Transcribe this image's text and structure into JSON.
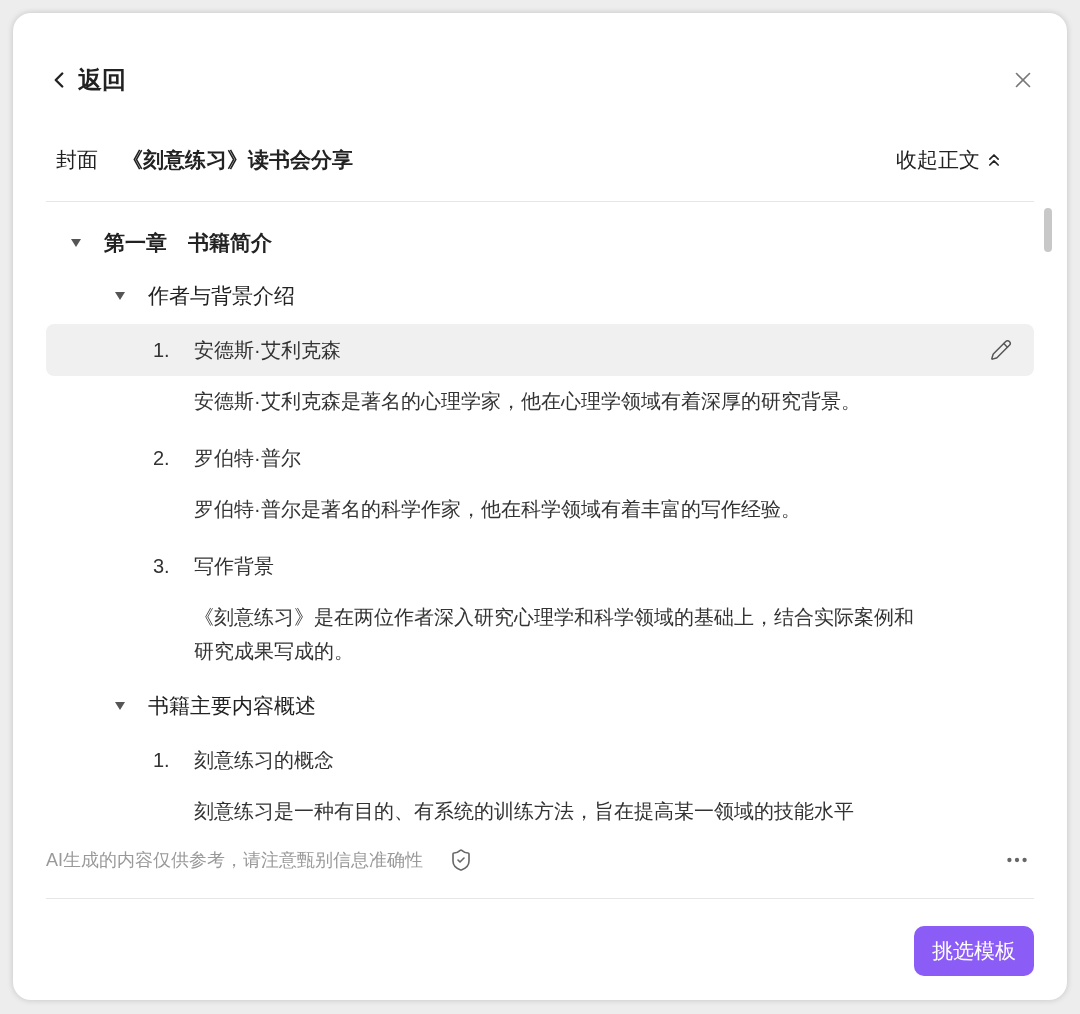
{
  "header": {
    "back_label": "返回"
  },
  "doc": {
    "cover_label": "封面",
    "title": "《刻意练习》读书会分享",
    "collapse_label": "收起正文"
  },
  "outline": [
    {
      "title": "第一章　书籍简介",
      "expanded": true,
      "children": [
        {
          "title": "作者与背景介绍",
          "expanded": true,
          "items": [
            {
              "number": "1.",
              "title": "安德斯·艾利克森",
              "selected": true,
              "body": "安德斯·艾利克森是著名的心理学家，他在心理学领域有着深厚的研究背景。"
            },
            {
              "number": "2.",
              "title": "罗伯特·普尔",
              "selected": false,
              "body": "罗伯特·普尔是著名的科学作家，他在科学领域有着丰富的写作经验。"
            },
            {
              "number": "3.",
              "title": "写作背景",
              "selected": false,
              "body": "《刻意练习》是在两位作者深入研究心理学和科学领域的基础上，结合实际案例和研究成果写成的。"
            }
          ]
        },
        {
          "title": "书籍主要内容概述",
          "expanded": true,
          "items": [
            {
              "number": "1.",
              "title": "刻意练习的概念",
              "selected": false,
              "body": "刻意练习是一种有目的、有系统的训练方法，旨在提高某一领域的技能水平"
            }
          ]
        }
      ]
    }
  ],
  "footer": {
    "disclaimer": "AI生成的内容仅供参考，请注意甄别信息准确性"
  },
  "primary_button": "挑选模板"
}
